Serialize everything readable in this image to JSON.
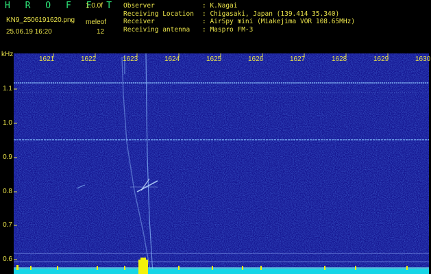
{
  "header": {
    "brand": "H R O F F T",
    "version": "1.0.0f",
    "filename": "KN9_2506191620.png",
    "station": "meleof",
    "datetime": "25.06.19 16:20",
    "index": "12"
  },
  "info": [
    {
      "label": "Observer",
      "value": ": K.Nagai"
    },
    {
      "label": "Receiving Location",
      "value": ": Chigasaki, Japan (139.414 35.340)"
    },
    {
      "label": "Receiver",
      "value": ": AirSpy mini (Miakejima VOR 108.65MHz)"
    },
    {
      "label": "Receiving antenna",
      "value": ": Maspro FM-3"
    }
  ],
  "spectrogram": {
    "y_unit": "kHz",
    "x_ticks": [
      "1621",
      "1622",
      "1623",
      "1624",
      "1625",
      "1626",
      "1627",
      "1628",
      "1629",
      "1630"
    ],
    "y_ticks": [
      "1.1",
      "1.0",
      "0.9",
      "0.8",
      "0.7",
      "0.6"
    ],
    "colors": {
      "background": "#1a1aa0",
      "trace": "#7fb6ff",
      "bottom": "#16d6e6",
      "burst": "#f2f20a",
      "text": "#e9e24a"
    }
  }
}
